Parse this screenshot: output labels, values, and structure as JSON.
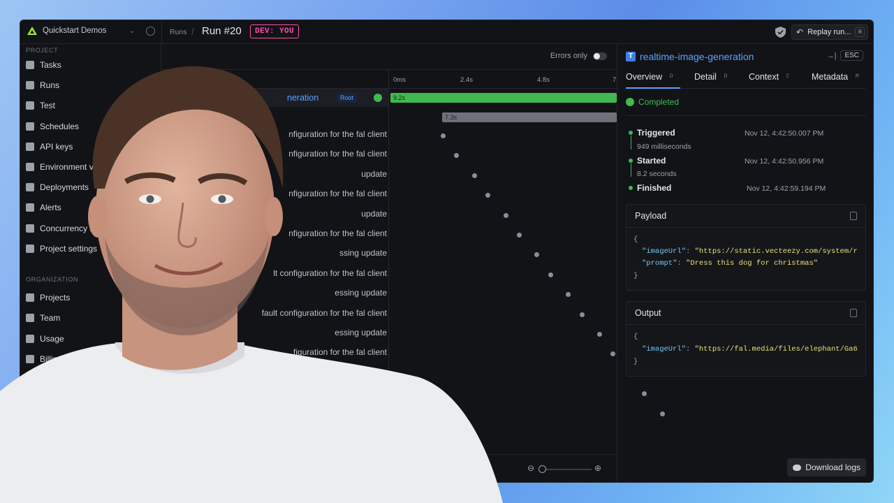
{
  "topbar": {
    "org_name": "Quickstart Demos",
    "breadcrumb": "Runs",
    "run_title": "Run #20",
    "env_badge": "DEV: YOU",
    "replay_label": "Replay run...",
    "replay_shortcut": "R"
  },
  "sidebar": {
    "project_label": "PROJECT",
    "project_items": [
      {
        "label": "Tasks",
        "icon": "tasks-icon"
      },
      {
        "label": "Runs",
        "icon": "runs-icon"
      },
      {
        "label": "Test",
        "icon": "test-icon"
      },
      {
        "label": "Schedules",
        "icon": "clock-icon"
      },
      {
        "label": "API keys",
        "icon": "key-icon"
      },
      {
        "label": "Environment v",
        "icon": "env-icon"
      },
      {
        "label": "Deployments",
        "icon": "stack-icon"
      },
      {
        "label": "Alerts",
        "icon": "bell-icon"
      },
      {
        "label": "Concurrency li",
        "icon": "concurrency-icon"
      },
      {
        "label": "Project settings",
        "icon": "gear-icon"
      }
    ],
    "org_label": "ORGANIZATION",
    "org_items": [
      {
        "label": "Projects",
        "icon": "folder-icon"
      },
      {
        "label": "Team",
        "icon": "team-icon"
      },
      {
        "label": "Usage",
        "icon": "chart-icon"
      },
      {
        "label": "Billing",
        "icon": "card-icon"
      }
    ]
  },
  "run_view": {
    "errors_only_label": "Errors only",
    "ticks": [
      "0ms",
      "2.4s",
      "4.8s",
      "7"
    ],
    "root": {
      "name": "neration",
      "badge": "Root",
      "duration": "9.2s"
    },
    "child_duration": "7.3s",
    "rows": [
      "nfiguration for the fal client",
      "nfiguration for the fal client",
      "update",
      "nfiguration for the fal client",
      "update",
      "nfiguration for the fal client",
      "ssing update",
      "lt configuration for the fal client",
      "essing update",
      "fault configuration for the fal client",
      "essing update",
      "figuration for the fal client"
    ]
  },
  "inspector": {
    "task_icon_letter": "T",
    "task_name": "realtime-image-generation",
    "esc_label": "ESC",
    "tabs": [
      {
        "label": "Overview",
        "key": "O"
      },
      {
        "label": "Detail",
        "key": "D"
      },
      {
        "label": "Context",
        "key": "C"
      },
      {
        "label": "Metadata",
        "key": "M"
      }
    ],
    "status": "Completed",
    "timeline": {
      "triggered": {
        "label": "Triggered",
        "date": "Nov 12, 4:42:50.007 PM"
      },
      "gap1": "949 milliseconds",
      "started": {
        "label": "Started",
        "date": "Nov 12, 4:42:50.956 PM"
      },
      "gap2": "8.2 seconds",
      "finished": {
        "label": "Finished",
        "date": "Nov 12, 4:42:59.194 PM"
      }
    },
    "payload": {
      "title": "Payload",
      "open": "{",
      "line1_key": "\"imageUrl\"",
      "line1_val": "\"https://static.vecteezy.com/system/r",
      "line2_key": "\"prompt\"",
      "line2_val": "\"Dress this dog for christmas\"",
      "close": "}"
    },
    "output": {
      "title": "Output",
      "open": "{",
      "line1_key": "\"imageUrl\"",
      "line1_val": "\"https://fal.media/files/elephant/Ga6",
      "close": "}"
    },
    "download_label": "Download logs"
  },
  "colors": {
    "accent_blue": "#5aa3ff",
    "success_green": "#3fb950",
    "dev_pink": "#ff4fa8"
  }
}
